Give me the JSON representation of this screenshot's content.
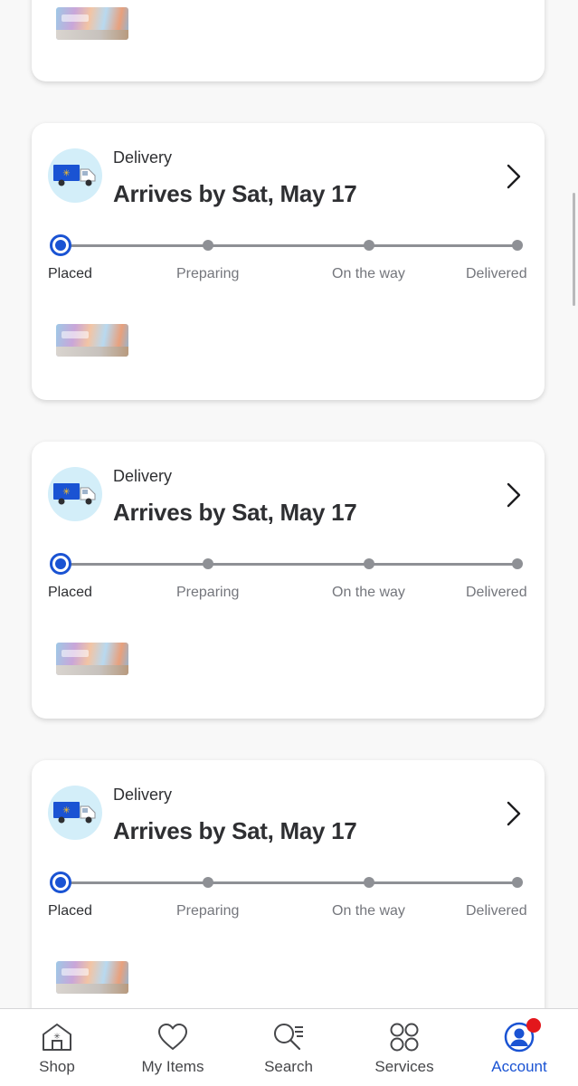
{
  "orders": [
    {
      "type": "Delivery",
      "arrival": "Arrives by Sat, May 17",
      "steps": [
        "Placed",
        "Preparing",
        "On the way",
        "Delivered"
      ],
      "current_step": 0
    },
    {
      "type": "Delivery",
      "arrival": "Arrives by Sat, May 17",
      "steps": [
        "Placed",
        "Preparing",
        "On the way",
        "Delivered"
      ],
      "current_step": 0
    },
    {
      "type": "Delivery",
      "arrival": "Arrives by Sat, May 17",
      "steps": [
        "Placed",
        "Preparing",
        "On the way",
        "Delivered"
      ],
      "current_step": 0
    }
  ],
  "tabbar": {
    "items": [
      {
        "label": "Shop",
        "icon": "store-icon"
      },
      {
        "label": "My Items",
        "icon": "heart-icon"
      },
      {
        "label": "Search",
        "icon": "search-icon"
      },
      {
        "label": "Services",
        "icon": "services-grid-icon"
      },
      {
        "label": "Account",
        "icon": "account-icon"
      }
    ],
    "active_index": 4,
    "account_badge": true
  },
  "colors": {
    "accent_blue": "#1a53d3",
    "truck_circle": "#d3eef9",
    "badge_red": "#e3171c"
  }
}
